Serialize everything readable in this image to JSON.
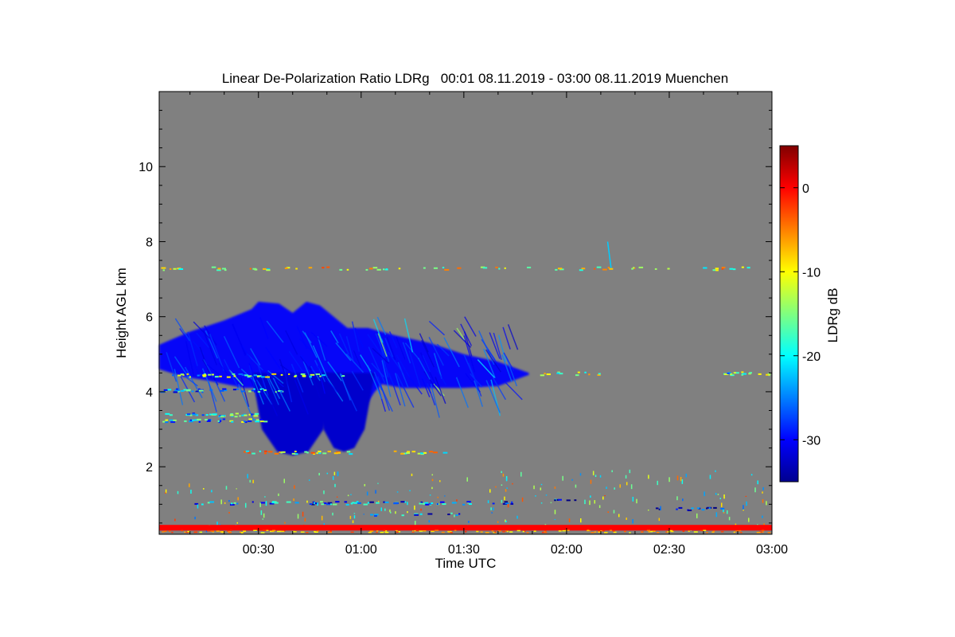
{
  "chart_data": {
    "type": "heatmap",
    "title": "Linear De-Polarization Ratio LDRg   00:01 08.11.2019 - 03:00 08.11.2019 Muenchen",
    "xlabel": "Time UTC",
    "ylabel": "Height AGL km",
    "xlim": [
      "00:01",
      "03:00"
    ],
    "ylim": [
      0.2,
      12
    ],
    "x_ticks": [
      "00:30",
      "01:00",
      "01:30",
      "02:00",
      "02:30",
      "03:00"
    ],
    "y_ticks": [
      "2",
      "4",
      "6",
      "8",
      "10"
    ],
    "grid": false,
    "background_color": "#808080",
    "colorbar": {
      "label": "LDRg dB",
      "range": [
        -35,
        5
      ],
      "ticks": [
        "0",
        "-10",
        "-20",
        "-30"
      ],
      "colormap": "jet"
    },
    "features": [
      {
        "name": "ice cloud layer",
        "x_range": [
          "00:01",
          "01:50"
        ],
        "height_km": [
          2.3,
          6.5
        ],
        "ldr_db": -30
      },
      {
        "name": "fall streak 1",
        "time": "00:40",
        "height_km": [
          2.3,
          4.5
        ],
        "ldr_db": -32
      },
      {
        "name": "fall streak 2",
        "time": "00:55",
        "height_km": [
          2.4,
          4.5
        ],
        "ldr_db": -32
      },
      {
        "name": "surface overlap layer",
        "x_range": [
          "00:01",
          "03:00"
        ],
        "height_km": [
          0.3,
          0.45
        ],
        "ldr_db": 0
      },
      {
        "name": "sparse echo line",
        "x_range": [
          "00:10",
          "01:25"
        ],
        "height_km": 1.05,
        "ldr_db": -25
      },
      {
        "name": "sparse echo line upper",
        "x_range": [
          "00:01",
          "03:00"
        ],
        "height_km": 7.3,
        "ldr_db": -12
      }
    ]
  }
}
